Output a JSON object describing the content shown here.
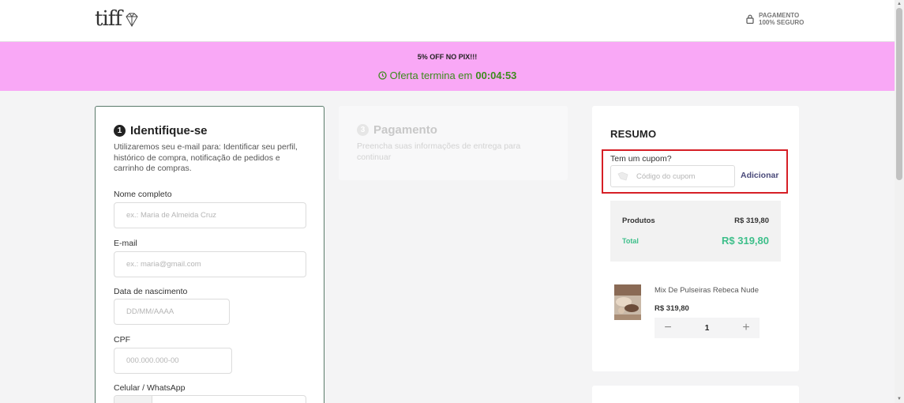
{
  "header": {
    "logo_text": "tiff",
    "logo_icon": "diamond-icon",
    "secure_line1": "PAGAMENTO",
    "secure_line2": "100% SEGURO",
    "secure_icon": "lock-icon"
  },
  "promo": {
    "title": "5% OFF NO PIX!!!",
    "timer_label": "Oferta termina em",
    "timer_value": "00:04:53",
    "clock_icon": "clock-icon",
    "background_color": "#f9a8f6",
    "accent_color": "#3d8b1e"
  },
  "identify": {
    "step_number": "1",
    "title": "Identifique-se",
    "description": "Utilizaremos seu e-mail para: Identificar seu perfil, histórico de compra, notificação de pedidos e carrinho de compras.",
    "fields": {
      "name_label": "Nome completo",
      "name_placeholder": "ex.: Maria de Almeida Cruz",
      "email_label": "E-mail",
      "email_placeholder": "ex.: maria@gmail.com",
      "birth_label": "Data de nascimento",
      "birth_placeholder": "DD/MM/AAAA",
      "cpf_label": "CPF",
      "cpf_placeholder": "000.000.000-00",
      "phone_label": "Celular / WhatsApp"
    }
  },
  "payment": {
    "step_number": "3",
    "title": "Pagamento",
    "description": "Preencha suas informações de entrega para continuar"
  },
  "summary": {
    "title": "RESUMO",
    "coupon_label": "Tem um cupom?",
    "coupon_placeholder": "Código do cupom",
    "coupon_icon": "tag-icon",
    "coupon_button": "Adicionar",
    "products_label": "Produtos",
    "products_value": "R$ 319,80",
    "total_label": "Total",
    "total_value": "R$ 319,80",
    "total_color": "#3dbf8a",
    "highlight_color": "#d61f26",
    "item": {
      "name": "Mix De Pulseiras Rebeca Nude",
      "price": "R$ 319,80",
      "quantity": "1",
      "minus_icon": "minus-icon",
      "plus_icon": "plus-icon"
    }
  }
}
